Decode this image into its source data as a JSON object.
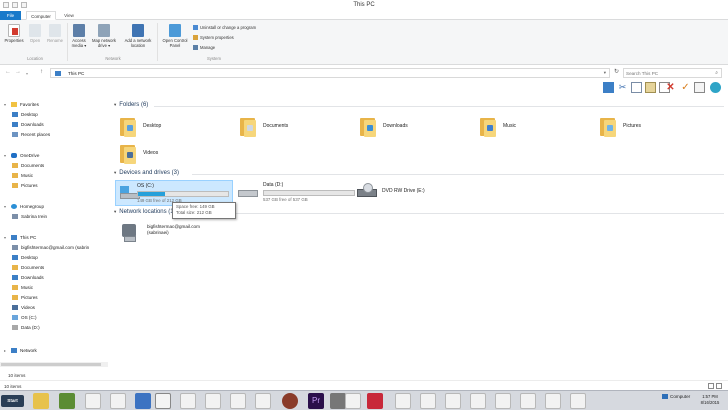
{
  "window": {
    "title": "This PC"
  },
  "tabs": [
    {
      "label": "File"
    },
    {
      "label": "Computer"
    },
    {
      "label": "View"
    }
  ],
  "ribbon": {
    "location": [
      {
        "label": "Properties"
      },
      {
        "label": "Open"
      },
      {
        "label": "Rename"
      }
    ],
    "network": [
      {
        "label": "Access media ▾"
      },
      {
        "label": "Map network drive ▾"
      },
      {
        "label": "Add a network location"
      }
    ],
    "system_large": {
      "label": "Open Control Panel"
    },
    "system_small": [
      {
        "label": "Uninstall or change a program"
      },
      {
        "label": "System properties"
      },
      {
        "label": "Manage"
      }
    ],
    "groups": {
      "location": "Location",
      "network": "Network",
      "system": "System"
    }
  },
  "address": {
    "path": "This PC",
    "search_placeholder": "Search This PC"
  },
  "nav": {
    "favorites": {
      "label": "Favorites",
      "items": [
        "Desktop",
        "Downloads",
        "Recent places"
      ]
    },
    "onedrive": {
      "label": "OneDrive",
      "items": [
        "Documents",
        "Music",
        "Pictures"
      ]
    },
    "homegroup": {
      "label": "Homegroup",
      "items": [
        "Sabrina Irein"
      ]
    },
    "thispc": {
      "label": "This PC",
      "items": [
        "bigfishtermac@gmail.com (sabrin",
        "Desktop",
        "Documents",
        "Downloads",
        "Music",
        "Pictures",
        "Videos",
        "OS (C:)",
        "Data (D:)"
      ]
    },
    "network": {
      "label": "Network"
    },
    "count": "10 items"
  },
  "sections": {
    "folders": "Folders (6)",
    "devices": "Devices and drives (3)",
    "netloc": "Network locations (1)"
  },
  "folders": [
    {
      "label": "Desktop",
      "emblem": "#5aa0de"
    },
    {
      "label": "Documents",
      "emblem": "#cfd7e2"
    },
    {
      "label": "Downloads",
      "emblem": "#3b8fd6"
    },
    {
      "label": "Music",
      "emblem": "#3f7fcf"
    },
    {
      "label": "Pictures",
      "emblem": "#6fb3e8"
    },
    {
      "label": "Videos",
      "emblem": "#4a6e9a"
    }
  ],
  "drives": [
    {
      "name": "OS (C:)",
      "free": "149 GB free of 212 GB",
      "used_fraction": 0.3
    },
    {
      "name": "Data (D:)",
      "free": "537 GB free of 537 GB",
      "used_fraction": 0.0
    },
    {
      "name": "DVD RW Drive (E:)"
    }
  ],
  "tooltip": {
    "line1": "Space free: 149 GB",
    "line2": "Total size: 212 GB"
  },
  "network_location": {
    "line1": "bigfishtermac@gmail.com",
    "line2": "(sabrinaei)"
  },
  "status": {
    "count": "10 items"
  },
  "taskbar": {
    "start": "Start",
    "computer": "Computer",
    "time": "1:57 PM",
    "date": "8/16/2015"
  },
  "colors": {
    "accent": "#1979ca",
    "selection": "#cce8ff",
    "drive_bar": "#26a0da"
  }
}
